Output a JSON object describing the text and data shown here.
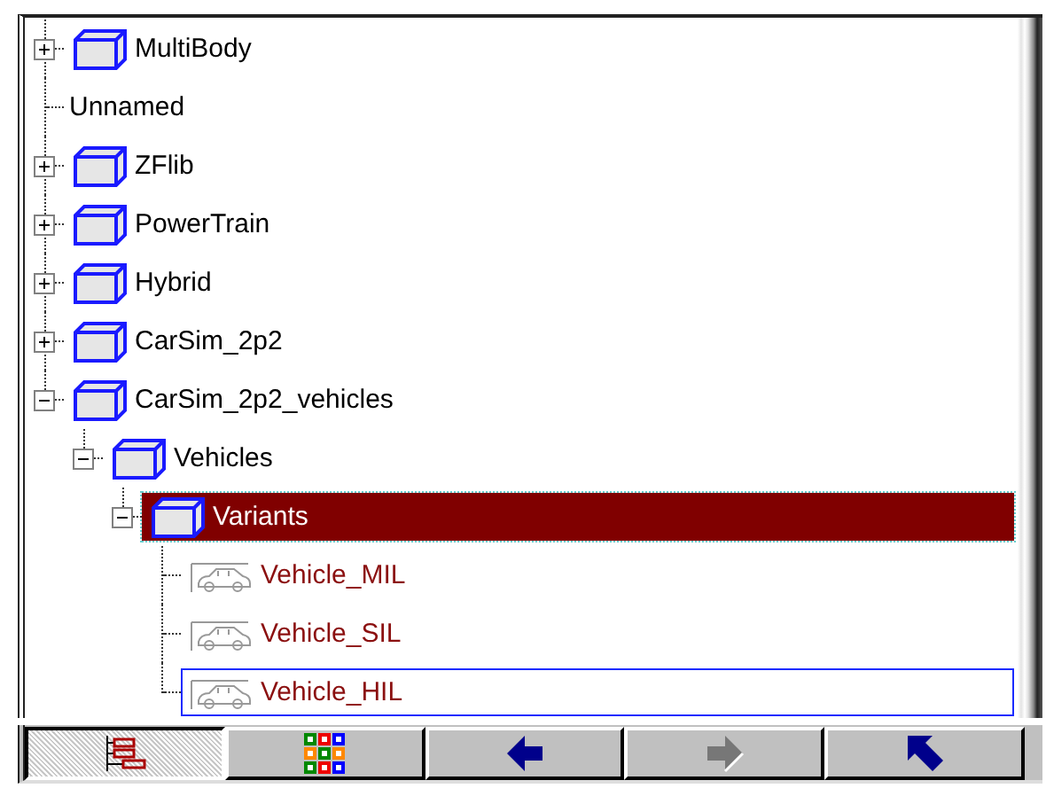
{
  "tree": {
    "items": [
      {
        "label": "MultiBody",
        "kind": "folder",
        "expanded": false,
        "selected": false,
        "focused": false
      },
      {
        "label": "Unnamed",
        "kind": "plain",
        "selected": false,
        "focused": false
      },
      {
        "label": "ZFlib",
        "kind": "folder",
        "expanded": false,
        "selected": false,
        "focused": false
      },
      {
        "label": "PowerTrain",
        "kind": "folder",
        "expanded": false,
        "selected": false,
        "focused": false
      },
      {
        "label": "Hybrid",
        "kind": "folder",
        "expanded": false,
        "selected": false,
        "focused": false
      },
      {
        "label": "CarSim_2p2",
        "kind": "folder",
        "expanded": false,
        "selected": false,
        "focused": false
      },
      {
        "label": "CarSim_2p2_vehicles",
        "kind": "folder",
        "expanded": true,
        "selected": false,
        "focused": false,
        "children": [
          {
            "label": "Vehicles",
            "kind": "folder",
            "expanded": true,
            "selected": false,
            "focused": false,
            "children": [
              {
                "label": "Variants",
                "kind": "folder",
                "expanded": true,
                "selected": true,
                "focused": false,
                "children": [
                  {
                    "label": "Vehicle_MIL",
                    "kind": "vehicle",
                    "selected": false,
                    "focused": false
                  },
                  {
                    "label": "Vehicle_SIL",
                    "kind": "vehicle",
                    "selected": false,
                    "focused": false
                  },
                  {
                    "label": "Vehicle_HIL",
                    "kind": "vehicle",
                    "selected": false,
                    "focused": true
                  }
                ]
              }
            ]
          }
        ]
      }
    ]
  },
  "toolbar": {
    "buttons": [
      {
        "pressed": true,
        "disabled": false
      },
      {
        "pressed": false,
        "disabled": false
      },
      {
        "pressed": false,
        "disabled": false
      },
      {
        "pressed": false,
        "disabled": true
      },
      {
        "pressed": false,
        "disabled": false
      }
    ]
  }
}
